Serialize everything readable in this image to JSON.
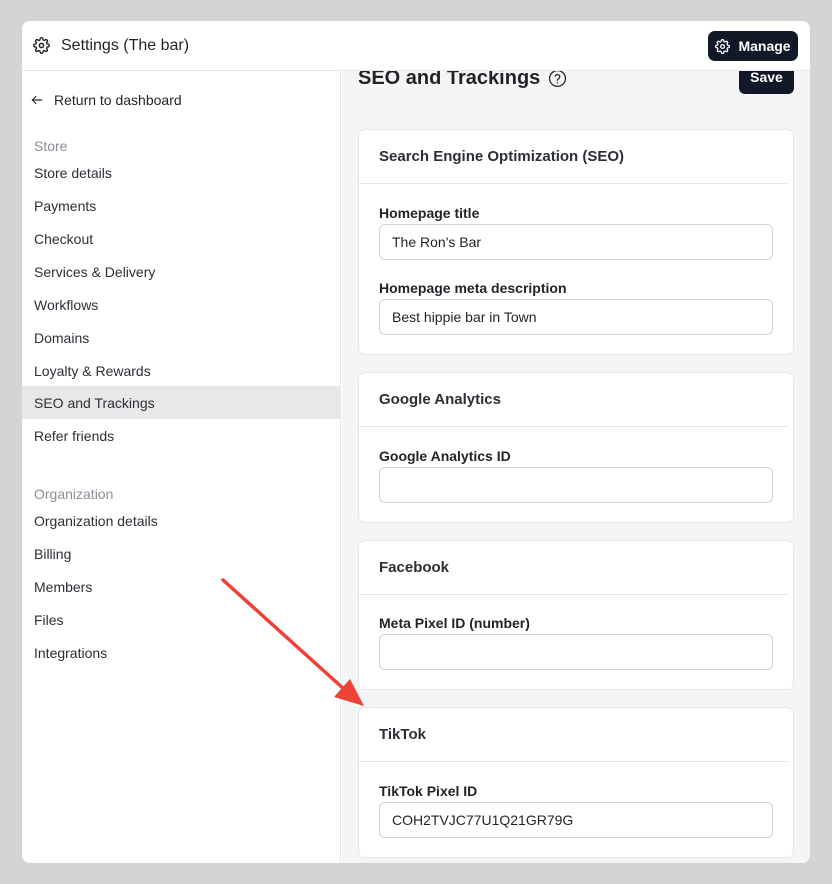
{
  "topbar": {
    "title": "Settings (The bar)",
    "manage_label": "Manage"
  },
  "sidebar": {
    "back_label": "Return to dashboard",
    "store_label": "Store",
    "store_items": [
      {
        "label": "Store details"
      },
      {
        "label": "Payments"
      },
      {
        "label": "Checkout"
      },
      {
        "label": "Services & Delivery"
      },
      {
        "label": "Workflows"
      },
      {
        "label": "Domains"
      },
      {
        "label": "Loyalty & Rewards"
      },
      {
        "label": "SEO and Trackings",
        "active": true
      },
      {
        "label": "Refer friends"
      }
    ],
    "org_label": "Organization",
    "org_items": [
      {
        "label": "Organization details"
      },
      {
        "label": "Billing"
      },
      {
        "label": "Members"
      },
      {
        "label": "Files"
      },
      {
        "label": "Integrations"
      }
    ]
  },
  "main": {
    "title": "SEO and Trackings",
    "save_label": "Save",
    "seo": {
      "header": "Search Engine Optimization (SEO)",
      "homepage_title_label": "Homepage title",
      "homepage_title_value": "The Ron's Bar",
      "meta_description_label": "Homepage meta description",
      "meta_description_value": "Best hippie bar in Town"
    },
    "google": {
      "header": "Google Analytics",
      "id_label": "Google Analytics ID",
      "id_value": ""
    },
    "facebook": {
      "header": "Facebook",
      "pixel_label": "Meta Pixel ID (number)",
      "pixel_value": ""
    },
    "tiktok": {
      "header": "TikTok",
      "pixel_label": "TikTok Pixel ID",
      "pixel_value": "COH2TVJC77U1Q21GR79G"
    }
  },
  "colors": {
    "accent_dark": "#111827",
    "annotation_arrow": "#ef4136",
    "active_nav": "#e8e8e8"
  },
  "icons": [
    "gear-icon",
    "arrow-left-icon",
    "help-circle-icon",
    "annotation-arrow"
  ]
}
